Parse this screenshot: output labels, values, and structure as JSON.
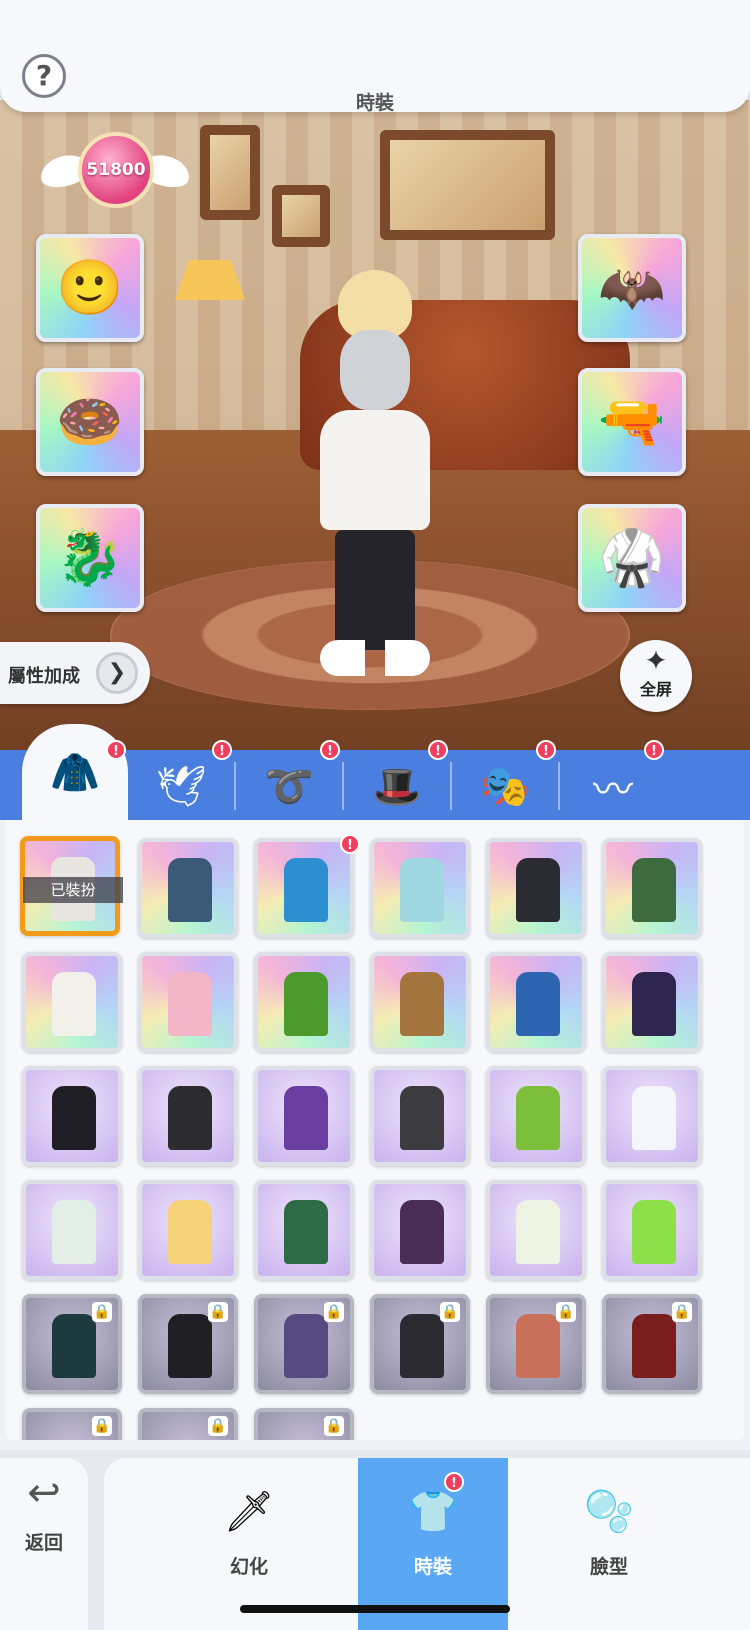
{
  "header": {
    "title": "時裝",
    "help_icon": "?"
  },
  "currency": {
    "amount": "51800"
  },
  "equip_slots_left": [
    {
      "name": "face-accessory",
      "icon": "🙂"
    },
    {
      "name": "mouth-accessory",
      "icon": "🍩"
    },
    {
      "name": "tail",
      "icon": "🐉"
    }
  ],
  "equip_slots_right": [
    {
      "name": "back-accessory",
      "icon": "🦇"
    },
    {
      "name": "hand-accessory",
      "icon": "🔫"
    },
    {
      "name": "outfit",
      "icon": "🥋"
    }
  ],
  "attr_button": {
    "label": "屬性加成",
    "arrow": "❯"
  },
  "fullscreen": {
    "label": "全屏",
    "icon": "✦"
  },
  "categories": [
    {
      "name": "outfit",
      "icon": "🧥",
      "badge": "!"
    },
    {
      "name": "wings",
      "icon": "🕊",
      "badge": "!"
    },
    {
      "name": "tail",
      "icon": "➰",
      "badge": "!"
    },
    {
      "name": "hat",
      "icon": "🎩",
      "badge": "!"
    },
    {
      "name": "mask",
      "icon": "🎭",
      "badge": "!"
    },
    {
      "name": "mustache",
      "icon": "〰",
      "badge": "!"
    }
  ],
  "items": {
    "equipped_label": "已裝扮",
    "new_badge": "!",
    "lock_icon": "🔒"
  },
  "bottom_nav": {
    "back": {
      "label": "返回",
      "icon": "↩"
    },
    "tabs": [
      {
        "label": "幻化",
        "icon": "🗡"
      },
      {
        "label": "時裝",
        "icon": "👕",
        "badge": "!"
      },
      {
        "label": "臉型",
        "icon": "🫧"
      }
    ]
  },
  "colors": {
    "accent_blue": "#4a7fe0",
    "active_tab": "#5aa8f3",
    "equipped_border": "#f39a1b",
    "badge_red": "#f23d5c"
  }
}
